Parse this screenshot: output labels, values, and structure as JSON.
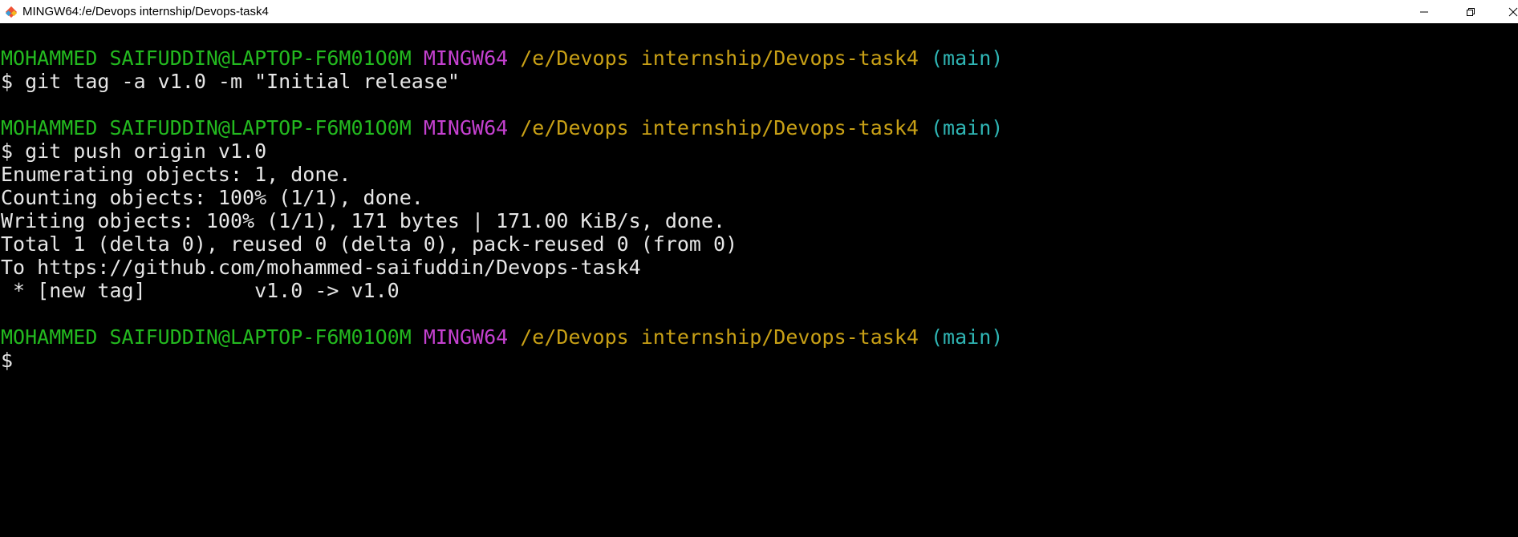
{
  "window": {
    "title": "MINGW64:/e/Devops internship/Devops-task4"
  },
  "colors": {
    "user": "#23b91f",
    "system": "#c541d0",
    "path": "#c8a016",
    "branch": "#2fb5b4",
    "text": "#e6e6e6",
    "background": "#000000"
  },
  "terminal": {
    "prompt1": {
      "user": "MOHAMMED SAIFUDDIN@LAPTOP-F6M01O0M",
      "system": "MINGW64",
      "path": "/e/Devops internship/Devops-task4",
      "branch": "(main)"
    },
    "cmd1": "$ git tag -a v1.0 -m \"Initial release\"",
    "prompt2": {
      "user": "MOHAMMED SAIFUDDIN@LAPTOP-F6M01O0M",
      "system": "MINGW64",
      "path": "/e/Devops internship/Devops-task4",
      "branch": "(main)"
    },
    "cmd2": "$ git push origin v1.0",
    "output": [
      "Enumerating objects: 1, done.",
      "Counting objects: 100% (1/1), done.",
      "Writing objects: 100% (1/1), 171 bytes | 171.00 KiB/s, done.",
      "Total 1 (delta 0), reused 0 (delta 0), pack-reused 0 (from 0)",
      "To https://github.com/mohammed-saifuddin/Devops-task4",
      " * [new tag]         v1.0 -> v1.0"
    ],
    "prompt3": {
      "user": "MOHAMMED SAIFUDDIN@LAPTOP-F6M01O0M",
      "system": "MINGW64",
      "path": "/e/Devops internship/Devops-task4",
      "branch": "(main)"
    },
    "cmd3": "$"
  }
}
